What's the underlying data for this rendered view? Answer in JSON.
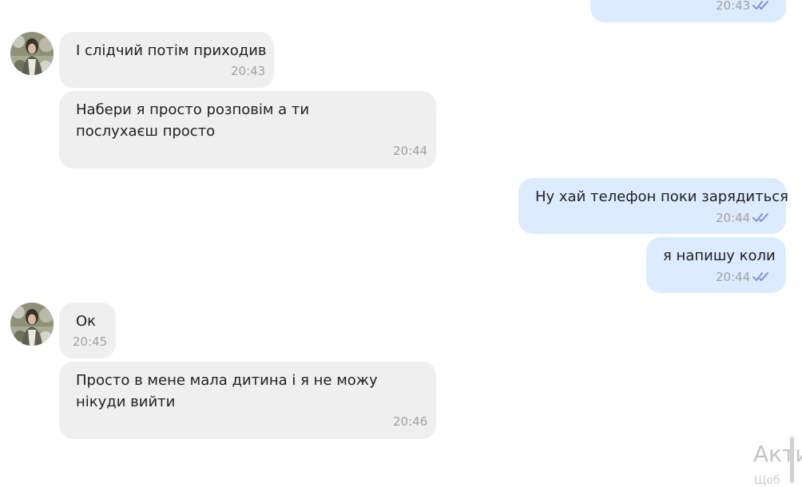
{
  "messages": [
    {
      "direction": "out",
      "text": "",
      "time": "20:43",
      "status": "read"
    },
    {
      "direction": "in",
      "text": "І слідчий потім приходив",
      "time": "20:43"
    },
    {
      "direction": "in",
      "text": "Набери я просто розповім а ти послухаєш просто",
      "time": "20:44"
    },
    {
      "direction": "out",
      "text": "Ну хай телефон поки зарядиться",
      "time": "20:44",
      "status": "read"
    },
    {
      "direction": "out",
      "text": "я напишу коли",
      "time": "20:44",
      "status": "read"
    },
    {
      "direction": "in",
      "text": "Ок",
      "time": "20:45"
    },
    {
      "direction": "in",
      "text": "Просто в мене мала дитина і я не можу нікуди вийти",
      "time": "20:46"
    }
  ],
  "avatars": [
    {
      "icon": "contact-avatar-icon"
    },
    {
      "icon": "contact-avatar-icon"
    }
  ],
  "watermark": {
    "title": "Акти",
    "subtitle": "Щоб"
  },
  "colors": {
    "incoming_bubble": "#efefef",
    "outgoing_bubble": "#dcebfd",
    "timestamp": "#a2a2a2",
    "read_check": "#7f88d8"
  }
}
